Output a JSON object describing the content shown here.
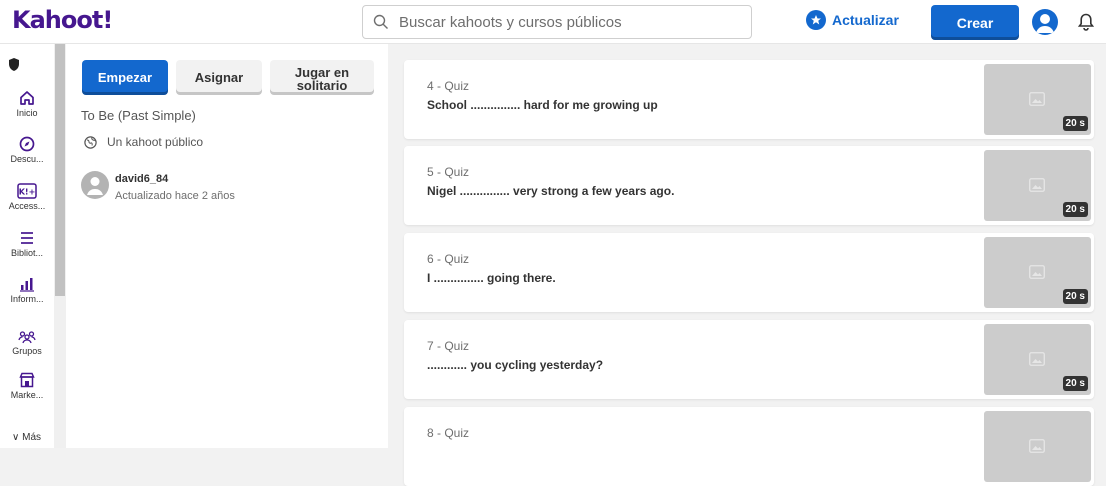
{
  "header": {
    "logo": "Kahoot!",
    "search_placeholder": "Buscar kahoots y cursos públicos",
    "upgrade_label": "Actualizar",
    "create_label": "Crear"
  },
  "sidebar": {
    "items": [
      {
        "label": "Inicio",
        "icon": "home-icon"
      },
      {
        "label": "Descu...",
        "icon": "compass-icon"
      },
      {
        "label": "Access...",
        "icon": "access-pass-icon"
      },
      {
        "label": "Bibliot...",
        "icon": "library-icon"
      },
      {
        "label": "Inform...",
        "icon": "reports-icon"
      },
      {
        "label": "Grupos",
        "icon": "groups-icon"
      },
      {
        "label": "Marke...",
        "icon": "marketplace-icon"
      }
    ],
    "more_label": "Más"
  },
  "kahoot": {
    "start_label": "Empezar",
    "assign_label": "Asignar",
    "solo_label_1": "Jugar en",
    "solo_label_2": "solitario",
    "title": "To Be (Past Simple)",
    "visibility": "Un kahoot público",
    "owner": "david6_84",
    "updated": "Actualizado hace 2 años"
  },
  "questions": [
    {
      "type": "4 - Quiz",
      "text": "School ............... hard for me growing up",
      "time": "20 s"
    },
    {
      "type": "5 - Quiz",
      "text": "Nigel ............... very strong a few years ago.",
      "time": "20 s"
    },
    {
      "type": "6 - Quiz",
      "text": "I ............... going there.",
      "time": "20 s"
    },
    {
      "type": "7 - Quiz",
      "text": "............ you cycling yesterday?",
      "time": "20 s"
    },
    {
      "type": "8 - Quiz",
      "text": "",
      "time": ""
    }
  ],
  "colors": {
    "brand_purple": "#46178f",
    "primary_blue": "#1368ce",
    "thumb_gray": "#cccccc"
  }
}
